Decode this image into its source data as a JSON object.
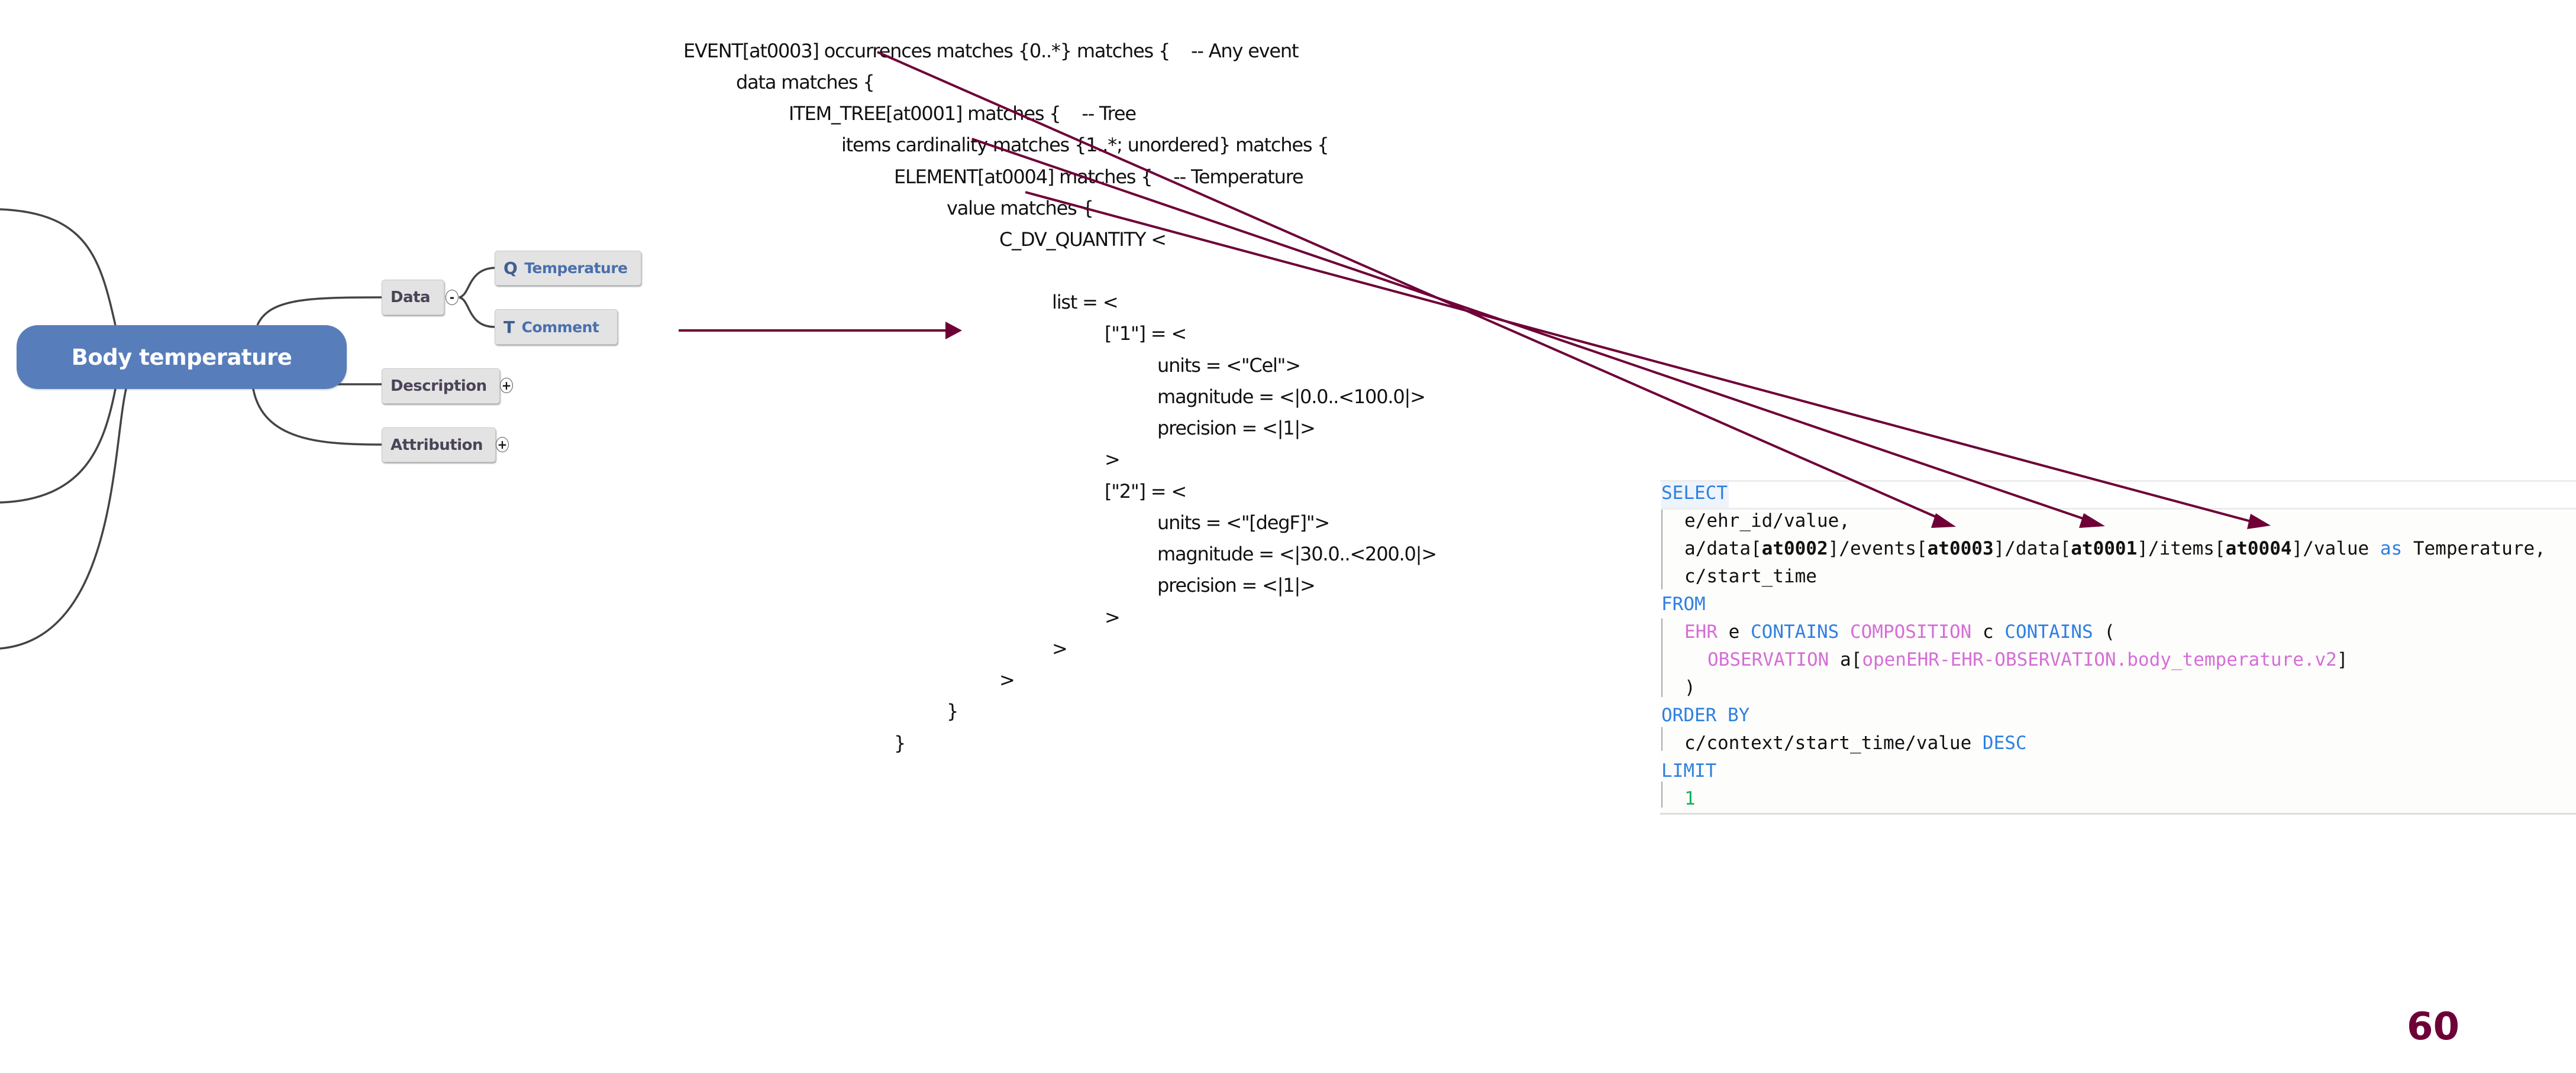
{
  "mindmap": {
    "central_node": "Body temperature",
    "branches": [
      {
        "label": "Data",
        "toggle": "-",
        "children": [
          {
            "label": "Temperature",
            "icon": "quantity-icon",
            "icon_glyph": "Q"
          },
          {
            "label": "Comment",
            "icon": "text-icon",
            "icon_glyph": "T"
          }
        ]
      },
      {
        "label": "Description",
        "toggle": "+"
      },
      {
        "label": "Attribution",
        "toggle": "+"
      }
    ],
    "colors": {
      "central_fill": "#577EBB",
      "node_fill": "#E3E3E3",
      "leaf_text": "#4A6FAD",
      "line": "#444444"
    }
  },
  "adl": {
    "lines": [
      "EVENT[at0003] occurrences matches {0..*} matches {    -- Any event",
      "data matches {",
      "ITEM_TREE[at0001] matches {    -- Tree",
      "items cardinality matches {1..*; unordered} matches {",
      "ELEMENT[at0004] matches {    -- Temperature",
      "value matches {",
      "C_DV_QUANTITY <",
      "list = <",
      "[\"1\"] = <",
      "units = <\"Cel\">",
      "magnitude = <|0.0..<100.0|>",
      "precision = <|1|>",
      ">",
      "[\"2\"] = <",
      "units = <\"[degF]\">",
      "magnitude = <|30.0..<200.0|>",
      "precision = <|1|>",
      ">",
      ">",
      ">",
      "}",
      "}"
    ]
  },
  "aql": {
    "select_kw": "SELECT",
    "select_1": "e/ehr_id/value,",
    "select_2_parts": [
      "a/data[",
      "at0002",
      "]/events[",
      "at0003",
      "]/data[",
      "at0001",
      "]/items[",
      "at0004",
      "]/value "
    ],
    "as_kw": "as",
    "alias": " Temperature,",
    "select_3": "c/start_time",
    "from_kw": "FROM",
    "from_ehr": "EHR",
    "from_e": " e ",
    "contains_kw": "CONTAINS",
    "composition": "COMPOSITION",
    "from_c": " c ",
    "open_paren": " (",
    "observation": "OBSERVATION",
    "obs_alias": " a[",
    "archetype_id": "openEHR-EHR-OBSERVATION.body_temperature.v2",
    "close_bracket": "]",
    "close_paren": ")",
    "order_kw": "ORDER BY",
    "order_expr": "c/context/start_time/value ",
    "desc_kw": "DESC",
    "limit_kw": "LIMIT",
    "limit_value": "1",
    "colors": {
      "keyword": "#2F80E0",
      "class": "#D56ED6",
      "number": "#10B060"
    }
  },
  "annotations": {
    "arrow_color": "#6E0037",
    "mapping_arrows": [
      {
        "from": "EVENT[at0003]",
        "to": "events[at0003]"
      },
      {
        "from": "items cardinality",
        "to": "data[at0001]"
      },
      {
        "from": "ELEMENT[at0004]",
        "to": "items[at0004]"
      }
    ]
  },
  "page_number": "60"
}
